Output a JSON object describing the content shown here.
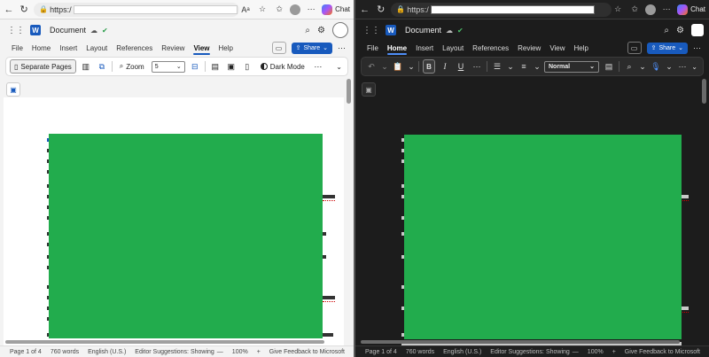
{
  "browser": {
    "url_prefix": "https:/",
    "chat_label": "Chat"
  },
  "word": {
    "doc_title": "Document",
    "app_letter": "W"
  },
  "left": {
    "tabs": [
      "File",
      "Home",
      "Insert",
      "Layout",
      "References",
      "Review",
      "View",
      "Help"
    ],
    "active_tab": "View",
    "share_label": "Share",
    "ribbon": {
      "separate_pages": "Separate Pages",
      "zoom_label": "Zoom",
      "zoom_value": "5",
      "dark_mode": "Dark Mode"
    }
  },
  "right": {
    "tabs": [
      "File",
      "Home",
      "Insert",
      "Layout",
      "References",
      "Review",
      "View",
      "Help"
    ],
    "active_tab": "Home",
    "share_label": "Share",
    "ribbon": {
      "style_value": "Normal",
      "bold": "B",
      "italic": "I",
      "underline": "U"
    }
  },
  "status": {
    "page": "Page 1 of 4",
    "words": "760 words",
    "language": "English (U.S.)",
    "editor": "Editor Suggestions: Showing",
    "zoom_minus": "—",
    "zoom": "100%",
    "zoom_plus": "+",
    "feedback": "Give Feedback to Microsoft"
  },
  "colors": {
    "accent": "#185abd",
    "redaction": "#22ac4d"
  }
}
